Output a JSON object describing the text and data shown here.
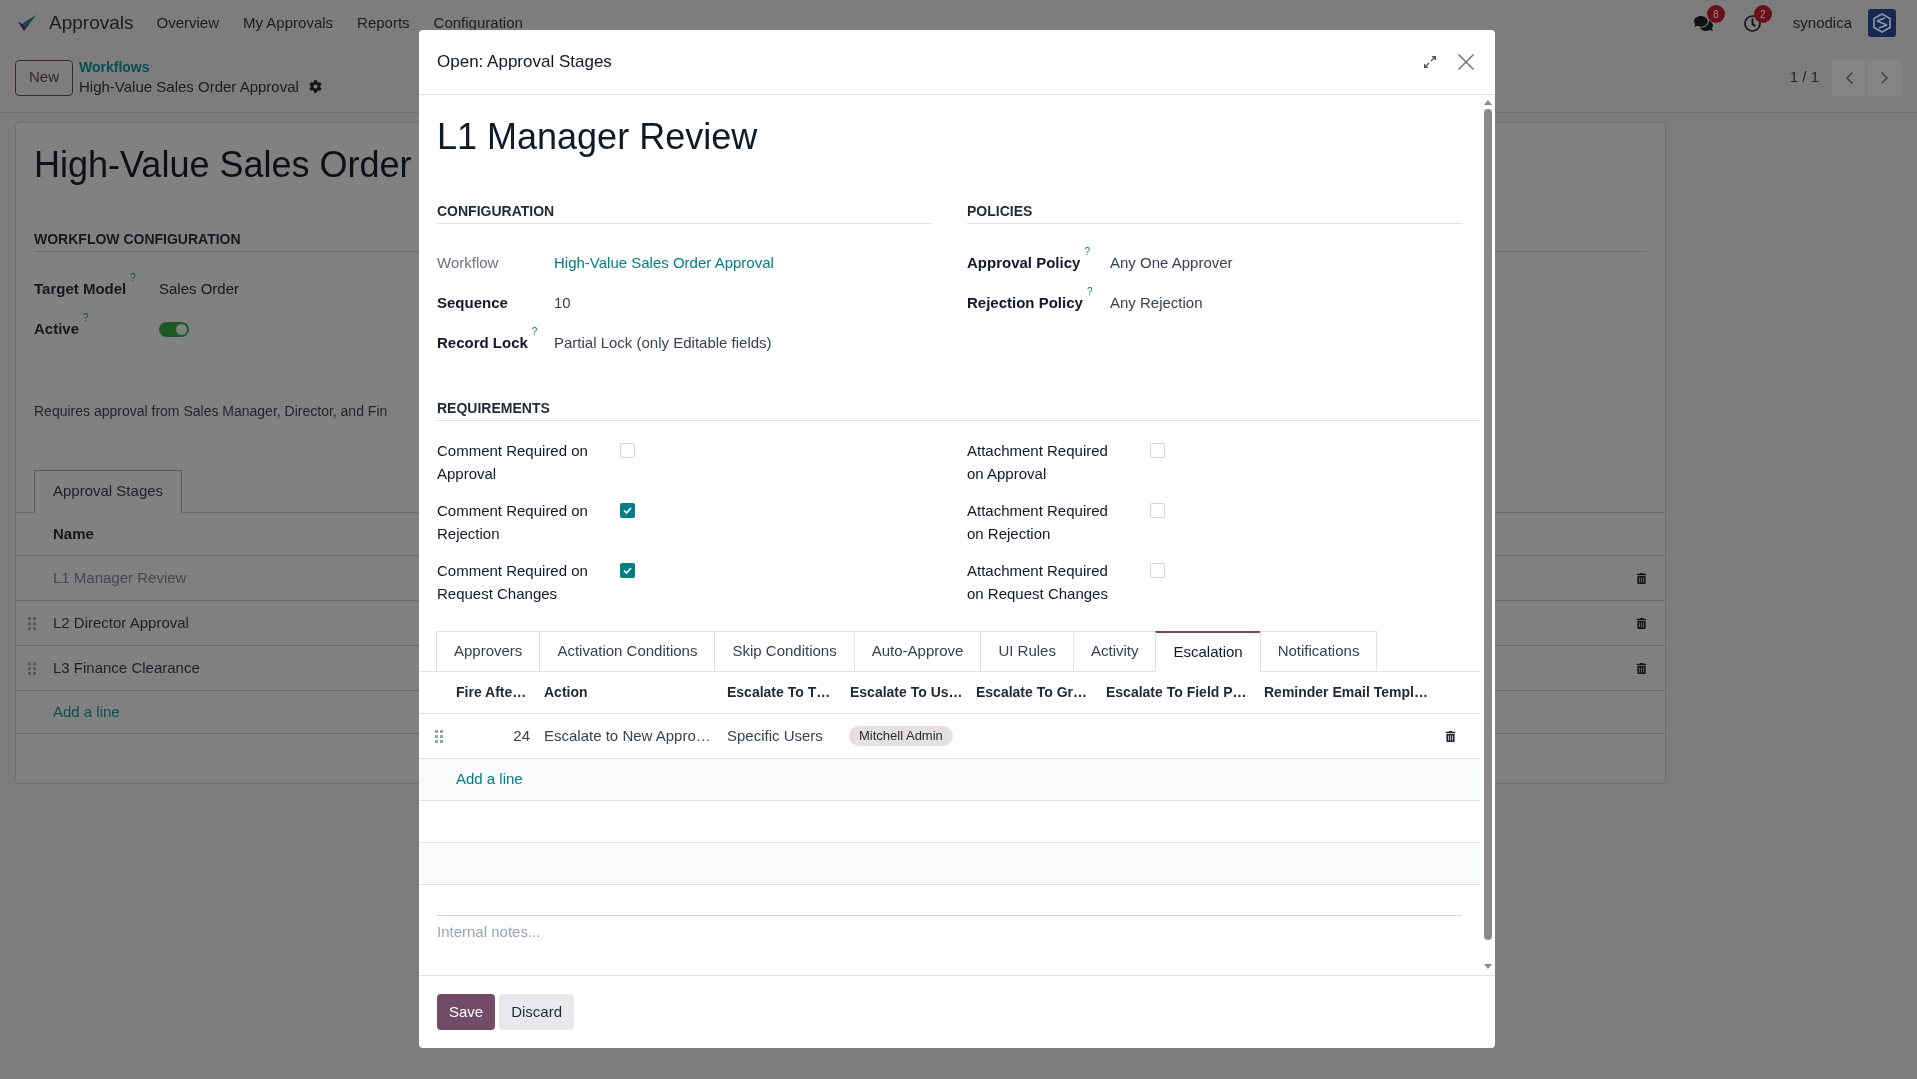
{
  "navbar": {
    "app_name": "Approvals",
    "menu": [
      "Overview",
      "My Approvals",
      "Reports",
      "Configuration"
    ],
    "message_count": "8",
    "activity_count": "2",
    "user": "synodica"
  },
  "control_panel": {
    "new_button": "New",
    "breadcrumb": "Workflows",
    "record_title": "High-Value Sales Order Approval",
    "pager": "1 / 1"
  },
  "form": {
    "title": "High-Value Sales Order",
    "section_title": "WORKFLOW CONFIGURATION",
    "fields": [
      {
        "kind": "text",
        "label": "Target Model",
        "help": "?",
        "value": "Sales Order"
      },
      {
        "kind": "toggle",
        "label": "Active",
        "help": "?",
        "on": true
      }
    ],
    "description": "Requires approval from Sales Manager, Director, and Fin",
    "tabs": [
      {
        "label": "Approval Stages",
        "selected": true
      }
    ],
    "stages_table": {
      "columns": [
        "Name"
      ],
      "rows": [
        {
          "name": "L1 Manager Review",
          "selected": true
        },
        {
          "name": "L2 Director Approval",
          "selected": false
        },
        {
          "name": "L3 Finance Clearance",
          "selected": false
        }
      ],
      "add_line": "Add a line"
    }
  },
  "dialog": {
    "title": "Open: Approval Stages",
    "record_name": "L1 Manager Review",
    "sections": [
      {
        "heading": "CONFIGURATION",
        "fields": [
          {
            "label": "Workflow",
            "readonly": true,
            "kind": "link",
            "value": "High-Value Sales Order Approval"
          },
          {
            "label": "Sequence",
            "readonly": false,
            "kind": "text",
            "value": "10"
          },
          {
            "label": "Record Lock",
            "readonly": false,
            "help": "?",
            "kind": "text",
            "value": "Partial Lock (only Editable fields)"
          }
        ]
      },
      {
        "heading": "POLICIES",
        "fields": [
          {
            "label": "Approval Policy",
            "readonly": false,
            "help": "?",
            "kind": "text",
            "value": "Any One Approver"
          },
          {
            "label": "Rejection Policy",
            "readonly": false,
            "help": "?",
            "kind": "text",
            "value": "Any Rejection"
          }
        ]
      }
    ],
    "requirements": {
      "heading": "REQUIREMENTS",
      "items": [
        {
          "label": "Comment Required on Approval",
          "checked": false
        },
        {
          "label": "Attachment Required on Approval",
          "checked": false
        },
        {
          "label": "Comment Required on Rejection",
          "checked": true
        },
        {
          "label": "Attachment Required on Rejection",
          "checked": false
        },
        {
          "label": "Comment Required on Request Changes",
          "checked": true
        },
        {
          "label": "Attachment Required on Request Changes",
          "checked": false
        }
      ]
    },
    "tabs": [
      {
        "label": "Approvers",
        "selected": false
      },
      {
        "label": "Activation Conditions",
        "selected": false
      },
      {
        "label": "Skip Conditions",
        "selected": false
      },
      {
        "label": "Auto-Approve",
        "selected": false
      },
      {
        "label": "UI Rules",
        "selected": false
      },
      {
        "label": "Activity",
        "selected": false
      },
      {
        "label": "Escalation",
        "selected": true
      },
      {
        "label": "Notifications",
        "selected": false
      }
    ],
    "escalation_table": {
      "columns": [
        "Fire Afte…",
        "Action",
        "Escalate To T…",
        "Escalate To Us…",
        "Escalate To Gr…",
        "Escalate To Field P…",
        "Reminder Email Templ…"
      ],
      "rows": [
        {
          "fire_after": "24",
          "action": "Escalate to New Appro…",
          "escalate_to_type": "Specific Users",
          "escalate_to_users": [
            "Mitchell Admin"
          ]
        }
      ],
      "add_line": "Add a line"
    },
    "notes": {
      "placeholder": "Internal notes..."
    },
    "buttons": [
      {
        "label": "Save",
        "kind": "primary"
      },
      {
        "label": "Discard",
        "kind": "secondary"
      }
    ]
  }
}
